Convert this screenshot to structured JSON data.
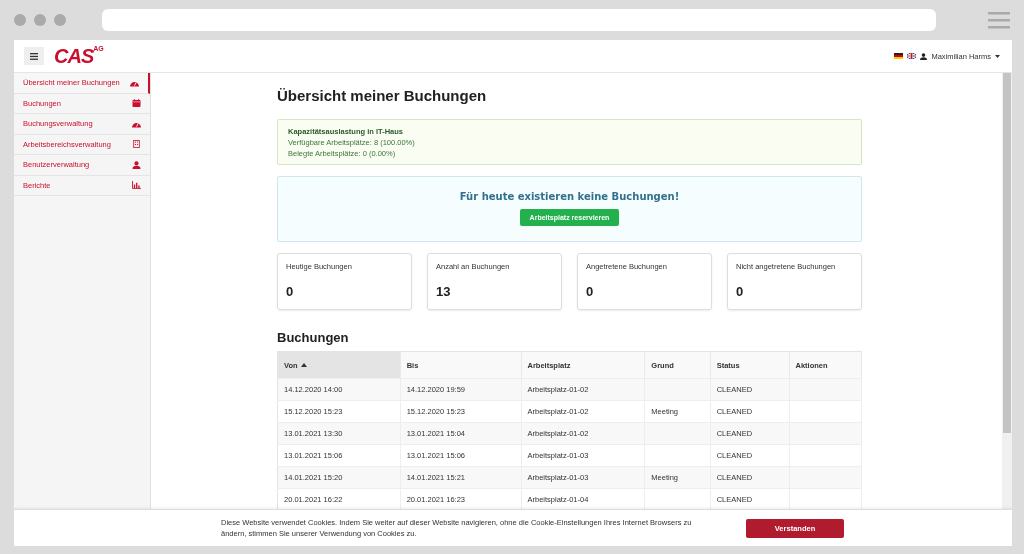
{
  "header": {
    "logo": "CAS",
    "logo_suffix": "AG",
    "user": "Maximilian Harms"
  },
  "sidebar": {
    "items": [
      {
        "label": "Übersicht meiner Buchungen",
        "kind": "gauge",
        "selected": true
      },
      {
        "label": "Buchungen",
        "kind": "calendar",
        "selected": false
      },
      {
        "label": "Buchungsverwaltung",
        "kind": "gauge",
        "selected": false
      },
      {
        "label": "Arbeitsbereichsverwaltung",
        "kind": "building",
        "selected": false
      },
      {
        "label": "Benutzerverwaltung",
        "kind": "user",
        "selected": false
      },
      {
        "label": "Berichte",
        "kind": "chart",
        "selected": false
      }
    ]
  },
  "page_title": "Übersicht meiner Buchungen",
  "capacity": {
    "title": "Kapazitätsauslastung in IT-Haus",
    "lines": [
      "Verfügbare Arbeitsplätze: 8 (100.00%)",
      "Belegte Arbeitsplätze: 0 (0.00%)"
    ]
  },
  "notice": {
    "message": "Für heute existieren keine Buchungen!",
    "button": "Arbeitsplatz reservieren"
  },
  "stats": [
    {
      "label": "Heutige Buchungen",
      "value": "0"
    },
    {
      "label": "Anzahl an Buchungen",
      "value": "13"
    },
    {
      "label": "Angetretene Buchungen",
      "value": "0"
    },
    {
      "label": "Nicht angetretene Buchungen",
      "value": "0"
    }
  ],
  "bookings": {
    "title": "Buchungen",
    "columns": [
      {
        "label": "Von",
        "sorted": true
      },
      {
        "label": "Bis",
        "sorted": false
      },
      {
        "label": "Arbeitsplatz",
        "sorted": false
      },
      {
        "label": "Grund",
        "sorted": false
      },
      {
        "label": "Status",
        "sorted": false
      },
      {
        "label": "Aktionen",
        "sorted": false
      }
    ],
    "rows": [
      {
        "von": "14.12.2020 14:00",
        "bis": "14.12.2020 19:59",
        "arbeitsplatz": "Arbeitsplatz-01-02",
        "status": "CLEANED"
      },
      {
        "von": "15.12.2020 15:23",
        "bis": "15.12.2020 15:23",
        "arbeitsplatz": "Arbeitsplatz-01-02",
        "grund": "Meeting",
        "status": "CLEANED"
      },
      {
        "von": "13.01.2021 13:30",
        "bis": "13.01.2021 15:04",
        "arbeitsplatz": "Arbeitsplatz-01-02",
        "status": "CLEANED"
      },
      {
        "von": "13.01.2021 15:06",
        "bis": "13.01.2021 15:06",
        "arbeitsplatz": "Arbeitsplatz-01-03",
        "status": "CLEANED"
      },
      {
        "von": "14.01.2021 15:20",
        "bis": "14.01.2021 15:21",
        "arbeitsplatz": "Arbeitsplatz-01-03",
        "grund": "Meeting",
        "status": "CLEANED"
      },
      {
        "von": "20.01.2021 16:22",
        "bis": "20.01.2021 16:23",
        "arbeitsplatz": "Arbeitsplatz-01-04",
        "status": "CLEANED"
      }
    ]
  },
  "cookie": {
    "text": "Diese Website verwendet Cookies. Indem Sie weiter auf dieser Website navigieren, ohne die Cookie-Einstellungen Ihres Internet Browsers zu ändern, stimmen Sie unserer Verwendung von Cookies zu.",
    "button": "Verstanden"
  }
}
